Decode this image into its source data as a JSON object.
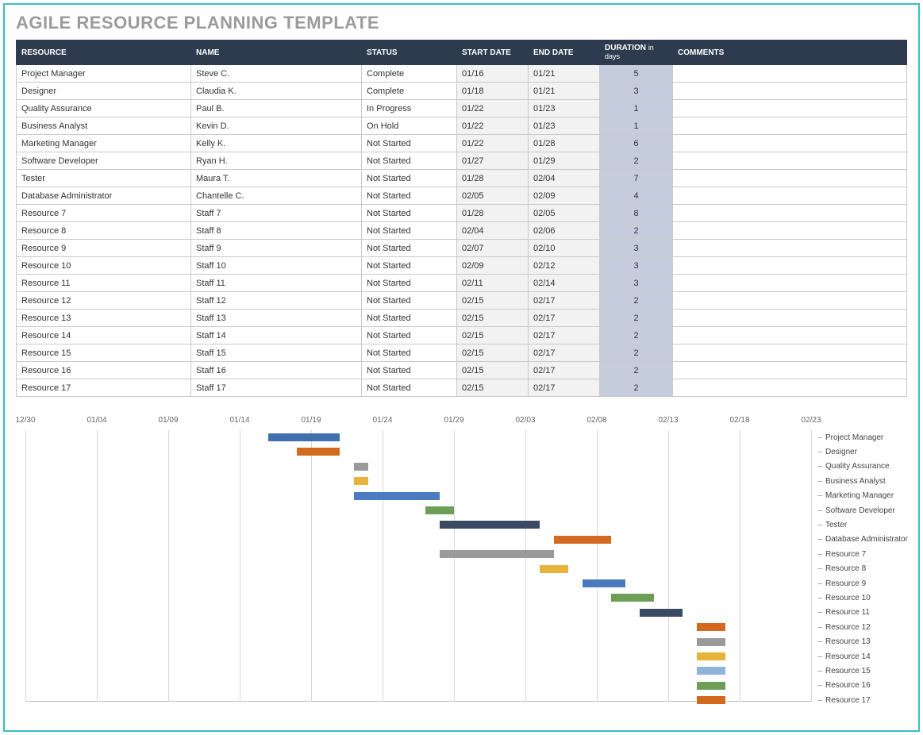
{
  "title": "AGILE RESOURCE PLANNING TEMPLATE",
  "table": {
    "headers": {
      "resource": "RESOURCE",
      "name": "NAME",
      "status": "STATUS",
      "start": "START DATE",
      "end": "END DATE",
      "duration": "DURATION",
      "duration_unit": "in days",
      "comments": "COMMENTS"
    },
    "rows": [
      {
        "resource": "Project Manager",
        "name": "Steve C.",
        "status": "Complete",
        "start": "01/16",
        "end": "01/21",
        "duration": "5",
        "comments": ""
      },
      {
        "resource": "Designer",
        "name": "Claudia K.",
        "status": "Complete",
        "start": "01/18",
        "end": "01/21",
        "duration": "3",
        "comments": ""
      },
      {
        "resource": "Quality Assurance",
        "name": "Paul B.",
        "status": "In Progress",
        "start": "01/22",
        "end": "01/23",
        "duration": "1",
        "comments": ""
      },
      {
        "resource": "Business Analyst",
        "name": "Kevin D.",
        "status": "On Hold",
        "start": "01/22",
        "end": "01/23",
        "duration": "1",
        "comments": ""
      },
      {
        "resource": "Marketing Manager",
        "name": "Kelly K.",
        "status": "Not Started",
        "start": "01/22",
        "end": "01/28",
        "duration": "6",
        "comments": ""
      },
      {
        "resource": "Software Developer",
        "name": "Ryan H.",
        "status": "Not Started",
        "start": "01/27",
        "end": "01/29",
        "duration": "2",
        "comments": ""
      },
      {
        "resource": "Tester",
        "name": "Maura T.",
        "status": "Not Started",
        "start": "01/28",
        "end": "02/04",
        "duration": "7",
        "comments": ""
      },
      {
        "resource": "Database Administrator",
        "name": "Chantelle C.",
        "status": "Not Started",
        "start": "02/05",
        "end": "02/09",
        "duration": "4",
        "comments": ""
      },
      {
        "resource": "Resource 7",
        "name": "Staff 7",
        "status": "Not Started",
        "start": "01/28",
        "end": "02/05",
        "duration": "8",
        "comments": ""
      },
      {
        "resource": "Resource 8",
        "name": "Staff 8",
        "status": "Not Started",
        "start": "02/04",
        "end": "02/06",
        "duration": "2",
        "comments": ""
      },
      {
        "resource": "Resource 9",
        "name": "Staff 9",
        "status": "Not Started",
        "start": "02/07",
        "end": "02/10",
        "duration": "3",
        "comments": ""
      },
      {
        "resource": "Resource 10",
        "name": "Staff 10",
        "status": "Not Started",
        "start": "02/09",
        "end": "02/12",
        "duration": "3",
        "comments": ""
      },
      {
        "resource": "Resource 11",
        "name": "Staff 11",
        "status": "Not Started",
        "start": "02/11",
        "end": "02/14",
        "duration": "3",
        "comments": ""
      },
      {
        "resource": "Resource 12",
        "name": "Staff 12",
        "status": "Not Started",
        "start": "02/15",
        "end": "02/17",
        "duration": "2",
        "comments": ""
      },
      {
        "resource": "Resource 13",
        "name": "Staff 13",
        "status": "Not Started",
        "start": "02/15",
        "end": "02/17",
        "duration": "2",
        "comments": ""
      },
      {
        "resource": "Resource 14",
        "name": "Staff 14",
        "status": "Not Started",
        "start": "02/15",
        "end": "02/17",
        "duration": "2",
        "comments": ""
      },
      {
        "resource": "Resource 15",
        "name": "Staff 15",
        "status": "Not Started",
        "start": "02/15",
        "end": "02/17",
        "duration": "2",
        "comments": ""
      },
      {
        "resource": "Resource 16",
        "name": "Staff 16",
        "status": "Not Started",
        "start": "02/15",
        "end": "02/17",
        "duration": "2",
        "comments": ""
      },
      {
        "resource": "Resource 17",
        "name": "Staff 17",
        "status": "Not Started",
        "start": "02/15",
        "end": "02/17",
        "duration": "2",
        "comments": ""
      }
    ]
  },
  "chart_data": {
    "type": "bar",
    "x_ticks": [
      "12/30",
      "01/04",
      "01/09",
      "01/14",
      "01/19",
      "01/24",
      "01/29",
      "02/03",
      "02/08",
      "02/13",
      "02/18",
      "02/23"
    ],
    "x_origin_serial": 0,
    "x_span_days": 55,
    "colors": [
      "#3e70ac",
      "#d2691e",
      "#9a9a9a",
      "#e8b33a",
      "#4a7bbf",
      "#6d9e55",
      "#3b4a63",
      "#d2691e",
      "#9a9a9a",
      "#e8b33a",
      "#4a7bbf",
      "#6d9e55",
      "#3b4a63",
      "#d2691e",
      "#9a9a9a",
      "#e8b33a",
      "#8fb3d9",
      "#6d9e55",
      "#d2691e"
    ],
    "series": [
      {
        "name": "Project Manager",
        "start_offset": 17,
        "duration": 5
      },
      {
        "name": "Designer",
        "start_offset": 19,
        "duration": 3
      },
      {
        "name": "Quality Assurance",
        "start_offset": 23,
        "duration": 1
      },
      {
        "name": "Business Analyst",
        "start_offset": 23,
        "duration": 1
      },
      {
        "name": "Marketing Manager",
        "start_offset": 23,
        "duration": 6
      },
      {
        "name": "Software Developer",
        "start_offset": 28,
        "duration": 2
      },
      {
        "name": "Tester",
        "start_offset": 29,
        "duration": 7
      },
      {
        "name": "Database Administrator",
        "start_offset": 37,
        "duration": 4
      },
      {
        "name": "Resource 7",
        "start_offset": 29,
        "duration": 8
      },
      {
        "name": "Resource 8",
        "start_offset": 36,
        "duration": 2
      },
      {
        "name": "Resource 9",
        "start_offset": 39,
        "duration": 3
      },
      {
        "name": "Resource 10",
        "start_offset": 41,
        "duration": 3
      },
      {
        "name": "Resource 11",
        "start_offset": 43,
        "duration": 3
      },
      {
        "name": "Resource 12",
        "start_offset": 47,
        "duration": 2
      },
      {
        "name": "Resource 13",
        "start_offset": 47,
        "duration": 2
      },
      {
        "name": "Resource 14",
        "start_offset": 47,
        "duration": 2
      },
      {
        "name": "Resource 15",
        "start_offset": 47,
        "duration": 2
      },
      {
        "name": "Resource 16",
        "start_offset": 47,
        "duration": 2
      },
      {
        "name": "Resource 17",
        "start_offset": 47,
        "duration": 2
      }
    ]
  }
}
